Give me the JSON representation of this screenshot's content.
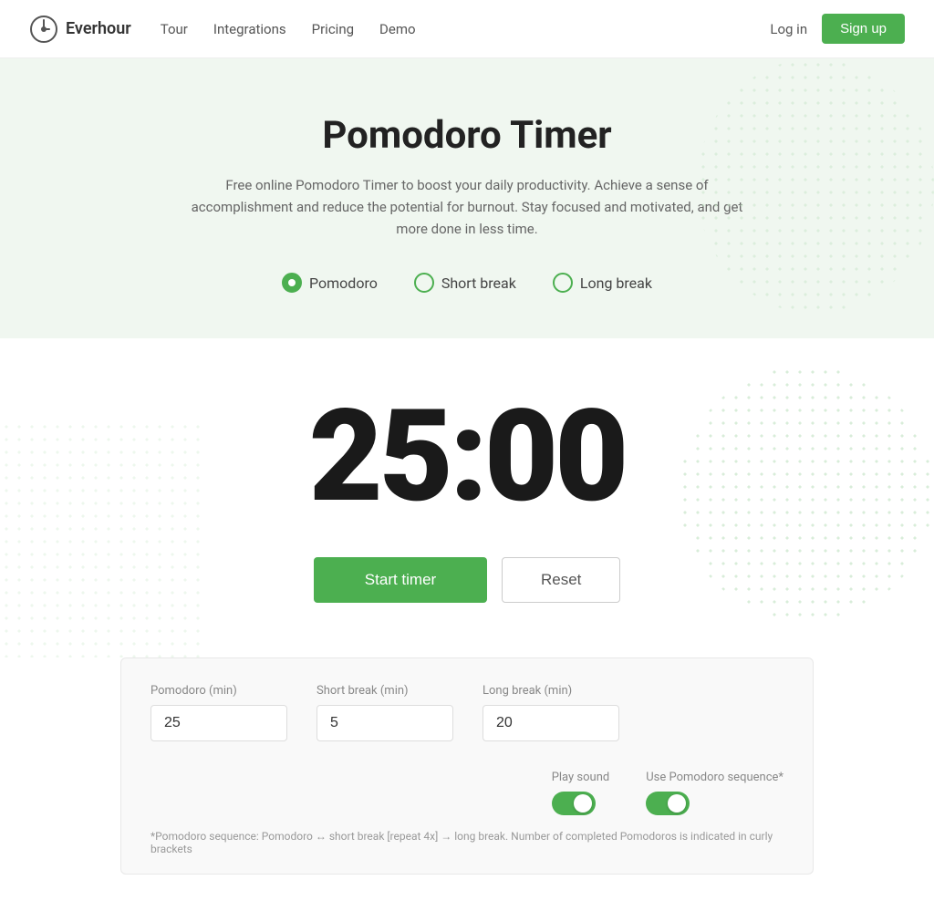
{
  "brand": {
    "name": "Everhour",
    "logo_icon": "clock"
  },
  "nav": {
    "links": [
      {
        "label": "Tour",
        "href": "#"
      },
      {
        "label": "Integrations",
        "href": "#"
      },
      {
        "label": "Pricing",
        "href": "#"
      },
      {
        "label": "Demo",
        "href": "#"
      }
    ],
    "login_label": "Log in",
    "signup_label": "Sign up"
  },
  "hero": {
    "title": "Pomodoro Timer",
    "description": "Free online Pomodoro Timer to boost your daily productivity. Achieve a sense of accomplishment and reduce the potential for burnout. Stay focused and motivated, and get more done in less time.",
    "modes": [
      {
        "label": "Pomodoro",
        "active": true
      },
      {
        "label": "Short break",
        "active": false
      },
      {
        "label": "Long break",
        "active": false
      }
    ]
  },
  "timer": {
    "display": "25:00",
    "start_label": "Start timer",
    "reset_label": "Reset"
  },
  "settings": {
    "fields": [
      {
        "label": "Pomodoro (min)",
        "value": "25",
        "id": "pomodoro"
      },
      {
        "label": "Short break (min)",
        "value": "5",
        "id": "short"
      },
      {
        "label": "Long break (min)",
        "value": "20",
        "id": "long"
      }
    ],
    "toggles": [
      {
        "label": "Play sound",
        "enabled": true
      },
      {
        "label": "Use Pomodoro sequence*",
        "enabled": true
      }
    ],
    "note": "*Pomodoro sequence: Pomodoro ↔ short break [repeat 4x] → long break. Number of completed Pomodoros is indicated in curly brackets"
  }
}
